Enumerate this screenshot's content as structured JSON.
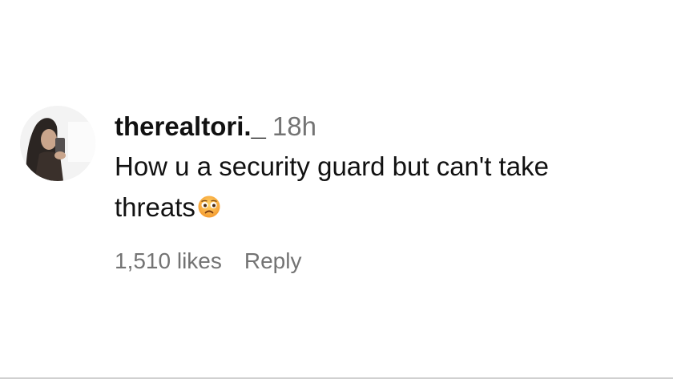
{
  "comment": {
    "avatar_icon": "profile-photo",
    "username": "therealtori._",
    "time": "18h",
    "text_line1": "How u a security guard but can't take",
    "text_line2": "threats",
    "emoji_icon": "frowning-face-emoji",
    "likes": "1,510 likes",
    "reply_label": "Reply"
  },
  "colors": {
    "text": "#111111",
    "muted": "#737373",
    "background": "#ffffff"
  }
}
